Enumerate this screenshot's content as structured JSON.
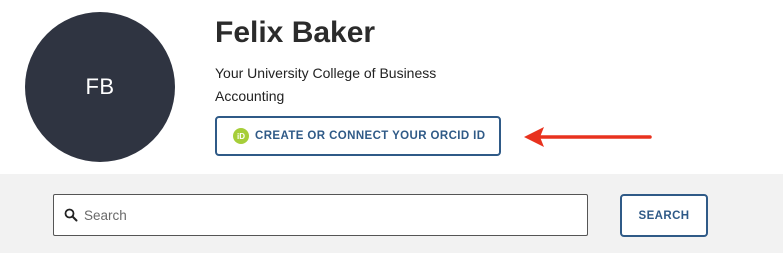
{
  "profile": {
    "initials": "FB",
    "name": "Felix Baker",
    "affiliation_line1": "Your University College of Business",
    "affiliation_line2": "Accounting",
    "orcid_button_label": "CREATE OR CONNECT YOUR ORCID ID",
    "orcid_icon_text": "iD"
  },
  "search": {
    "placeholder": "Search",
    "button_label": "SEARCH"
  },
  "colors": {
    "avatar_bg": "#2f3441",
    "accent": "#2f5a87",
    "orcid_green": "#a6ce39",
    "arrow": "#e8321e",
    "band_bg": "#f2f2f2"
  },
  "icons": {
    "orcid": "orcid-id-icon",
    "search": "search-icon",
    "annotation": "red-arrow-icon"
  }
}
